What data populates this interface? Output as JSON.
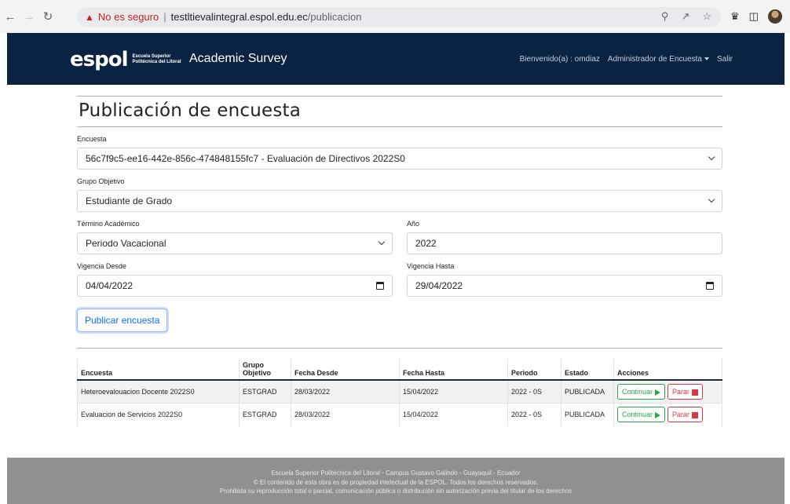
{
  "browser": {
    "security_label": "No es seguro",
    "url_host": "testltievalintegral.espol.edu.ec",
    "url_path": "/publicacion"
  },
  "navbar": {
    "logo_text": "espol",
    "logo_sub_line1": "Escuela Superior",
    "logo_sub_line2": "Politécnica del Litoral",
    "app_title": "Academic Survey",
    "welcome": "Bienvenido(a) : omdiaz",
    "role_menu": "Administrador de Encuesta",
    "logout": "Salir"
  },
  "form": {
    "title": "Publicación de encuesta",
    "survey_label": "Encuesta",
    "survey_value": "56c7f9c5-ee16-442e-856c-474848155fc7 - Evaluación de Directivos 2022S0",
    "group_label": "Grupo Objetivo",
    "group_value": "Estudiante de Grado",
    "term_label": "Término Académico",
    "term_value": "Periodo Vacacional",
    "year_label": "Año",
    "year_value": "2022",
    "from_label": "Vigencia Desde",
    "from_value": "04/04/2022",
    "to_label": "Vigencia Hasta",
    "to_value": "29/04/2022",
    "publish_button": "Publicar encuesta"
  },
  "table": {
    "headers": [
      "Encuesta",
      "Grupo Objetivo",
      "Fecha Desde",
      "Fecha Hasta",
      "Periodo",
      "Estado",
      "Acciones"
    ],
    "rows": [
      {
        "encuesta": "Heteroevalouacion Docente 2022S0",
        "grupo": "ESTGRAD",
        "desde": "28/03/2022",
        "hasta": "15/04/2022",
        "periodo": "2022 - 0S",
        "estado": "PUBLICADA",
        "continuar": "Continuar",
        "parar": "Parar"
      },
      {
        "encuesta": "Evaluacion de Servicios 2022S0",
        "grupo": "ESTGRAD",
        "desde": "28/03/2022",
        "hasta": "15/04/2022",
        "periodo": "2022 - 0S",
        "estado": "PUBLICADA",
        "continuar": "Continuar",
        "parar": "Parar"
      }
    ]
  },
  "footer": {
    "line1": "Escuela Superior Politécnica del Litoral - Campus Gustavo Galindo - Guayaquil - Ecuador",
    "line2": "© El contenido de esta obra es de propiedad intelectual de la ESPOL. Todos los derechos reservados.",
    "line3": "Prohibida su reproducción total o parcial, comunicación pública o distribución sin autorización previa del titular de los derechos"
  }
}
